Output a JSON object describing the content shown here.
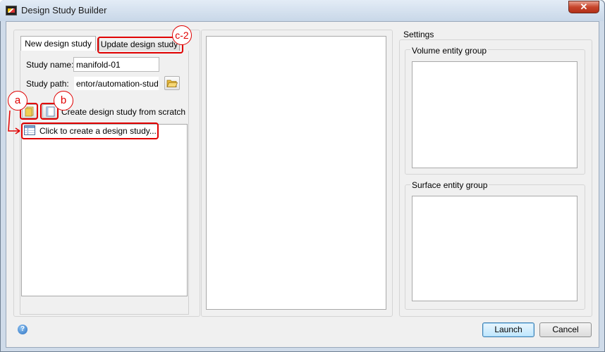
{
  "window": {
    "title": "Design Study Builder",
    "close_glyph": "✕"
  },
  "tabs": [
    {
      "label": "New design study"
    },
    {
      "label": "Update design study"
    }
  ],
  "form": {
    "study_name_label": "Study name:",
    "study_name_value": "manifold-01",
    "study_path_label": "Study path:",
    "study_path_value": "entor/automation-study",
    "scratch_label": "Create design study from scratch"
  },
  "list": {
    "create_item": "Click to create a design study..."
  },
  "settings": {
    "title": "Settings",
    "volume_group_label": "Volume entity group",
    "surface_group_label": "Surface entity group"
  },
  "footer": {
    "help_glyph": "?",
    "launch_label": "Launch",
    "cancel_label": "Cancel"
  },
  "annotations": {
    "a": "a",
    "b": "b",
    "c2": "c-2"
  },
  "colors": {
    "annotation": "#e00000",
    "title_bar": "#cfdbe9",
    "close_button": "#c7452c",
    "default_button_border": "#3c7fb1"
  },
  "icons": [
    "app-icon",
    "close-icon",
    "folder-open-icon",
    "open-study-icon",
    "new-study-icon",
    "study-table-icon",
    "help-icon"
  ]
}
